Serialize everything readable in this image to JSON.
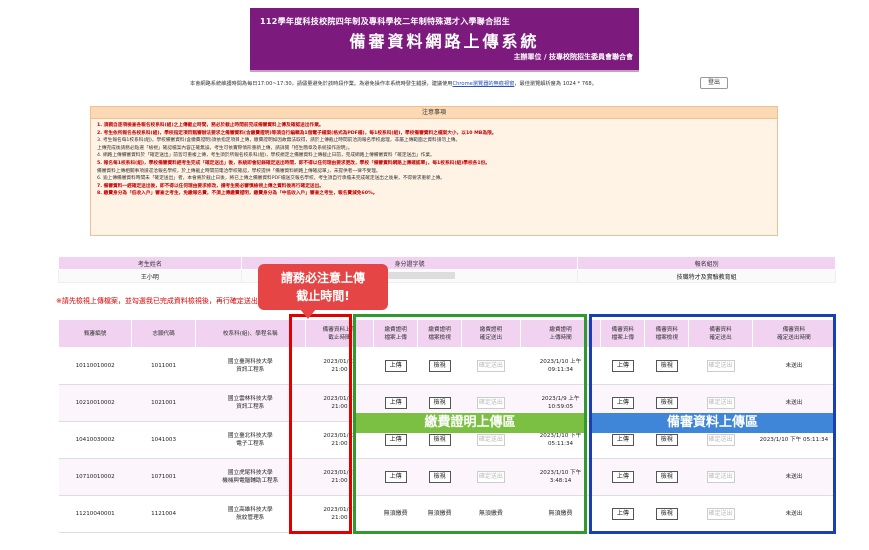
{
  "header": {
    "subtitle": "112學年度科技校院四年制及專科學校二年制特殊選才入學聯合招生",
    "title": "備審資料網路上傳系統",
    "organizer": "主辦單位 / 技專校院招生委員會聯合會"
  },
  "notice": {
    "text_before": "本會網路系統維護時間為每日17:00~17:30，請儘量避免於該時段作業。為避免操作本系統時發生錯誤，建議使用",
    "link": "Chrome瀏覽器的無痕視窗",
    "text_after": "，最佳瀏覽解析度為 1024 * 768。",
    "logout": "登出"
  },
  "notes": {
    "heading": "注意事項",
    "items": [
      {
        "text": "1. 須親自逐項檢查各報名校系科(組)之上傳截止時間，務必於截止時間前完成備審資料上傳及確認送出作業。",
        "red": true
      },
      {
        "text": "2. 考生依所報名各校系科(組)，學校指定項目甄審辦法要求之備審資料(含繳費證明)等須自行編輯為1個電子檔案(格式為PDF檔)，每1校系科(組)，學校備審資料之檔案大小，以10 MB為限。",
        "red": true
      },
      {
        "text": "3. 考生報名每1校系科(組)，學校備審資料(含繳費證明)須依指定項目上傳，繳費證明如因故無法取得，請於上傳截止時間前洽詢報名學校處理，非屬上傳範圍之資料請勿上傳。",
        "red": false
      },
      {
        "text": "   上傳完成後請務必點選「檢視」確認檔案內容正確無誤，考生可依實際情形重新上傳，請詳閱「招生簡章及系統操作說明」。",
        "red": false
      },
      {
        "text": "4. 網路上傳備審資料於「確定送出」前皆可重複上傳，考生須於所報名校系科(組)，學校規定之備審資料上傳截止日前，完成網路上傳備審資料「確定送出」作業。",
        "red": false
      },
      {
        "text": "5. 報名每1校系科(組)，學校備審資料經考生完成「確定送出」後，系統即會記錄確定送出時間，即不得以任何理由要求更改，學校「備審資料網路上傳確認單」，每1校系科(組)學校各1份。",
        "red": true
      },
      {
        "text": "   備審資料上傳相關事項請逕洽報名學校，於上傳截止時間前電洽學校確認，學校提供「備審資料網路上傳確認單」，未提供者一律不受理。",
        "red": false
      },
      {
        "text": "6. 逾上傳備審資料時間未「確定送出」者，本會將於截止日後，將已上傳之備審資料PDF檔送交報名學校，考生須自行承擔未完成確定送出之後果，不得要求重新上傳。",
        "red": false
      },
      {
        "text": "7. 備審資料一經確定送出後，即不得以任何理由要求修改，請考生務必審慎檢視上傳之資料後再行確定送出。",
        "red": true
      },
      {
        "text": "8. 繳費身分為「低收入戶」審查之考生，免繳報名費，不須上傳繳費證明，繳費身分為「中低收入戶」審查之考生，報名費減免60%。",
        "red": true
      }
    ]
  },
  "info_table": {
    "headers": [
      "考生姓名",
      "身分證字號",
      "報名組別"
    ],
    "values": [
      "王小明",
      "",
      "技職特才及實驗教育組"
    ]
  },
  "warning": "※請先檢視上傳檔案，並勾選我已完成資料檢視後，再行確定送出。",
  "callout": {
    "line1": "請務必注意上傳",
    "line2": "截止時間!"
  },
  "main_table": {
    "headers": [
      "甄審編號",
      "志願代碼",
      "校系科(組)、學程名稱",
      "備審資料上傳\n截止時間",
      "繳費證明\n檔案上傳",
      "繳費證明\n檔案檢視",
      "繳費證明\n確定送出",
      "繳費證明\n上傳時間",
      "備審資料\n檔案上傳",
      "備審資料\n檔案檢視",
      "備審資料\n確定送出",
      "備審資料\n確定送出時間"
    ],
    "rows": [
      {
        "id": "10110010002",
        "code": "1011001",
        "school": "國立臺灣科技大學",
        "dept": "資訊工程系",
        "deadline_date": "2023/01/13",
        "deadline_time": "21:00",
        "pay_upload": "上傳",
        "pay_view": "檢視",
        "pay_submit": "確定送出",
        "pay_time_date": "2023/1/10 上午",
        "pay_time_clock": "09:11:34",
        "doc_upload": "上傳",
        "doc_view": "檢視",
        "doc_submit": "確定送出",
        "doc_time": "未送出"
      },
      {
        "id": "10210010002",
        "code": "1021001",
        "school": "國立雲林科技大學",
        "dept": "資訊工程系",
        "deadline_date": "2023/01/11",
        "deadline_time": "21:00",
        "pay_upload": "上傳",
        "pay_view": "檢視",
        "pay_submit": "確定送出",
        "pay_time_date": "2023/1/9 上午",
        "pay_time_clock": "10:59:05",
        "doc_upload": "上傳",
        "doc_view": "檢視",
        "doc_submit": "確定送出",
        "doc_time": "未送出"
      },
      {
        "id": "10410030002",
        "code": "1041003",
        "school": "國立臺北科技大學",
        "dept": "電子工程系",
        "deadline_date": "2023/01/12",
        "deadline_time": "21:00",
        "pay_upload": "上傳",
        "pay_view": "檢視",
        "pay_submit": "確定送出",
        "pay_time_date": "2023/1/10 下午",
        "pay_time_clock": "05:11:34",
        "doc_upload": "上傳",
        "doc_view": "檢視",
        "doc_submit": "確定送出",
        "doc_time": "2023/1/10 下午 05:11:34"
      },
      {
        "id": "10710010002",
        "code": "1071001",
        "school": "國立虎尾科技大學",
        "dept": "機械與電腦輔助工程系",
        "deadline_date": "2023/01/11",
        "deadline_time": "21:00",
        "pay_upload": "上傳",
        "pay_view": "檢視",
        "pay_submit": "確定送出",
        "pay_time_date": "2023/1/10 下午",
        "pay_time_clock": "3:48:14",
        "doc_upload": "上傳",
        "doc_view": "檢視",
        "doc_submit": "確定送出",
        "doc_time": "未送出"
      },
      {
        "id": "11210040001",
        "code": "1121004",
        "school": "國立高雄科技大學",
        "dept": "航紋管理系",
        "deadline_date": "2023/01/11",
        "deadline_time": "21:00",
        "pay_upload": "無須繳費",
        "pay_view": "無須繳費",
        "pay_submit": "無須繳費",
        "pay_time_date": "無須繳費",
        "pay_time_clock": "",
        "doc_upload": "上傳",
        "doc_view": "檢視",
        "doc_submit": "確定送出",
        "doc_time": "未送出"
      }
    ]
  },
  "zones": {
    "payment": "繳費證明上傳區",
    "documents": "備審資料上傳區"
  },
  "colors": {
    "banner": "#7d1a7e",
    "header_cell": "#f1d3f1",
    "red_box": "#e00000",
    "green_box": "#2f9a2f",
    "blue_box": "#1a3fb5"
  }
}
